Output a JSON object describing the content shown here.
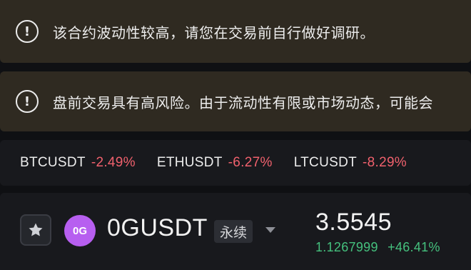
{
  "notices": [
    {
      "icon": "exclamation-circle-icon",
      "text": "该合约波动性较高，请您在交易前自行做好调研。"
    },
    {
      "icon": "exclamation-circle-icon",
      "text": "盘前交易具有高风险。由于流动性有限或市场动态，可能会"
    }
  ],
  "tickers": [
    {
      "symbol": "BTCUSDT",
      "change": "-2.49%"
    },
    {
      "symbol": "ETHUSDT",
      "change": "-6.27%"
    },
    {
      "symbol": "LTCUSDT",
      "change": "-8.29%"
    }
  ],
  "market": {
    "favorite_icon": "star-icon",
    "logo_text": "0G",
    "symbol": "0GUSDT",
    "contract_type": "永续",
    "price": "3.5545",
    "change_amount": "1.1267999",
    "change_percent": "+46.41%"
  },
  "colors": {
    "notice_bg": "#2f2a21",
    "negative": "#f0616d",
    "positive": "#45c17e",
    "logo": "#b75ff0"
  }
}
